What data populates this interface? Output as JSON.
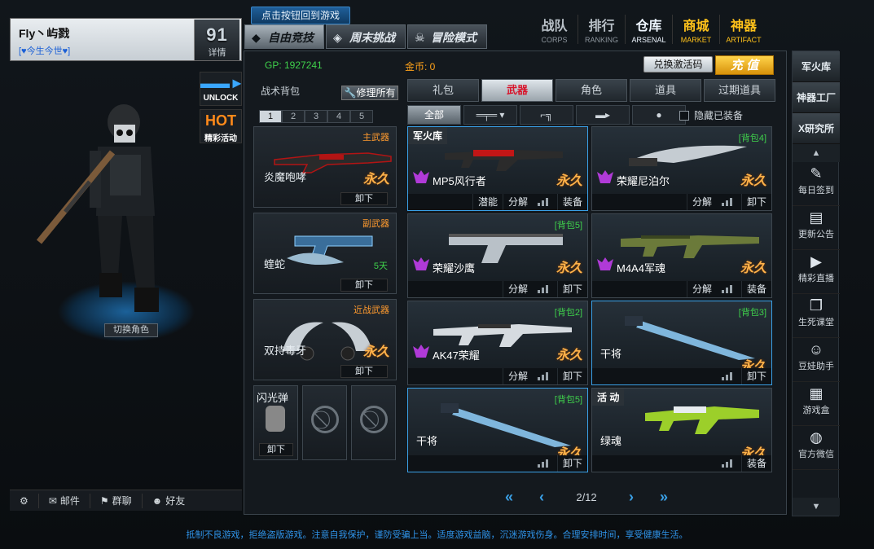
{
  "profile": {
    "name": "Fly丶屿戮",
    "motto": "[♥今生今世♥]",
    "rank_number": "91",
    "rank_label": "详情"
  },
  "side_icons": [
    {
      "label": "UNLOCK",
      "icon": "rifle-icon"
    },
    {
      "label": "精彩活动",
      "icon": "hot-icon",
      "badge": "HOT"
    }
  ],
  "switch_role": "切换角色",
  "bottom_left": [
    {
      "label": "",
      "icon": "gear-icon"
    },
    {
      "label": "邮件",
      "icon": "mail-icon"
    },
    {
      "label": "群聊",
      "icon": "group-chat-icon"
    },
    {
      "label": "好友",
      "icon": "friends-icon"
    }
  ],
  "return_tip": "点击按钮回到游戏",
  "modes": [
    {
      "label": "自由竞技",
      "active": true
    },
    {
      "label": "周末挑战",
      "active": false
    },
    {
      "label": "冒险模式",
      "active": false
    }
  ],
  "topnav": [
    {
      "cn": "战队",
      "en": "CORPS"
    },
    {
      "cn": "排行",
      "en": "RANKING"
    },
    {
      "cn": "仓库",
      "en": "ARSENAL"
    },
    {
      "cn": "商城",
      "en": "MARKET"
    },
    {
      "cn": "神器",
      "en": "ARTIFACT"
    }
  ],
  "currency": {
    "gp": "GP: 1927241",
    "gold": "金币: 0"
  },
  "redeem": "兑换激活码",
  "recharge": "充 值",
  "backpack": {
    "title": "战术背包",
    "repair_all": "修理所有",
    "tabs": [
      "1",
      "2",
      "3",
      "4",
      "5"
    ]
  },
  "slots": [
    {
      "category": "主武器",
      "name": "炎魔咆哮",
      "perm": "永久",
      "unequip": "卸下"
    },
    {
      "category": "副武器",
      "name": "蝰蛇",
      "days": "5天",
      "unequip": "卸下"
    },
    {
      "category": "近战武器",
      "name": "双持毒牙",
      "perm": "永久",
      "unequip": "卸下"
    }
  ],
  "small_slots": [
    {
      "label": "闪光弹",
      "unequip": "卸下"
    },
    {
      "label": "",
      "unequip": ""
    },
    {
      "label": "",
      "unequip": ""
    }
  ],
  "cat_tabs": [
    "礼包",
    "武器",
    "角色",
    "道具",
    "过期道具"
  ],
  "sub_tabs": [
    "全部",
    "",
    "",
    "",
    ""
  ],
  "hide_equipped": "隐藏已装备",
  "cards": [
    {
      "name": "MP5风行者",
      "perm": "永久",
      "tag": "军火库",
      "pack": "",
      "actions": [
        "潜能",
        "分解",
        "装备"
      ]
    },
    {
      "name": "荣耀尼泊尔",
      "perm": "永久",
      "tag": "",
      "pack": "[背包4]",
      "actions": [
        "分解",
        "卸下"
      ]
    },
    {
      "name": "荣耀沙鹰",
      "perm": "永久",
      "tag": "",
      "pack": "[背包5]",
      "actions": [
        "分解",
        "卸下"
      ]
    },
    {
      "name": "M4A4军魂",
      "perm": "永久",
      "tag": "",
      "pack": "",
      "actions": [
        "分解",
        "装备"
      ]
    },
    {
      "name": "AK47荣耀",
      "perm": "永久",
      "tag": "",
      "pack": "[背包2]",
      "actions": [
        "分解",
        "卸下"
      ]
    },
    {
      "name": "干将",
      "perm": "永久",
      "tag": "",
      "pack": "[背包3]",
      "actions": [
        "卸下"
      ]
    },
    {
      "name": "干将",
      "perm": "永久",
      "tag": "",
      "pack": "[背包5]",
      "actions": [
        "卸下"
      ]
    },
    {
      "name": "绿魂",
      "perm": "永久",
      "tag": "活 动",
      "pack": "",
      "actions": [
        "装备"
      ]
    }
  ],
  "pager": {
    "page": "2/12"
  },
  "right_tabs": [
    "军火库",
    "神器工厂",
    "X研究所"
  ],
  "right_items": [
    {
      "label": "每日签到",
      "icon": "checkin-icon"
    },
    {
      "label": "更新公告",
      "icon": "notice-icon"
    },
    {
      "label": "精彩直播",
      "icon": "live-icon"
    },
    {
      "label": "生死课堂",
      "icon": "classroom-icon"
    },
    {
      "label": "豆娃助手",
      "icon": "helper-icon"
    },
    {
      "label": "游戏盒",
      "icon": "gamebox-icon"
    },
    {
      "label": "官方微信",
      "icon": "wechat-icon"
    }
  ],
  "notice": "抵制不良游戏，拒绝盗版游戏。注意自我保护，谨防受骗上当。适度游戏益脑，沉迷游戏伤身。合理安排时间，享受健康生活。"
}
